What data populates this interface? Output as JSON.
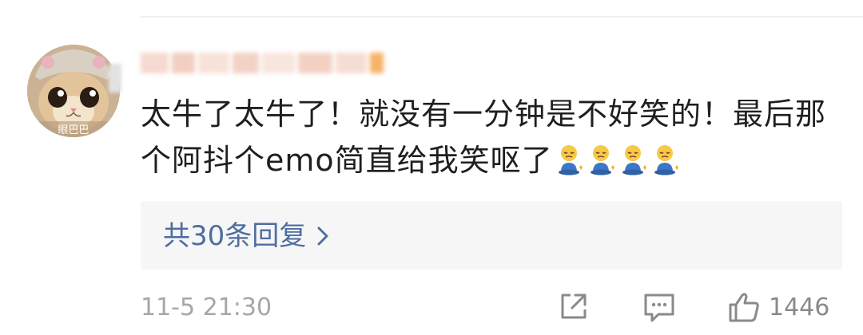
{
  "avatar": {
    "caption": "眼巴巴"
  },
  "comment": {
    "text": "太牛了太牛了！就没有一分钟是不好笑的！最后那个阿抖个emo简直给我笑呕了",
    "emoji_count": 4,
    "emoji_name": "meditating-face-emoji"
  },
  "replies": {
    "label": "共30条回复"
  },
  "footer": {
    "timestamp": "11-5 21:30",
    "like_count": "1446",
    "icons": [
      "share-icon",
      "comment-icon",
      "thumbs-up-icon"
    ]
  },
  "colors": {
    "link": "#4e6ea0",
    "meta": "#a6a6a6",
    "replies_bg": "#f6f6f6"
  }
}
